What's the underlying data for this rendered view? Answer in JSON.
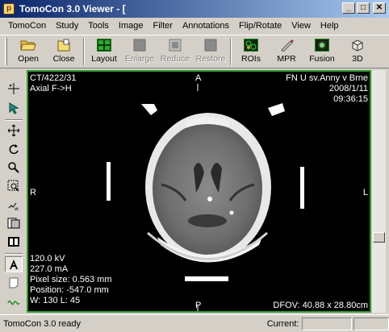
{
  "window": {
    "title": "TomoCon 3.0 Viewer - [",
    "app_icon_letter": "p",
    "minimize_label": "_",
    "maximize_label": "□",
    "close_label": "✕"
  },
  "menu": [
    "TomoCon",
    "Study",
    "Tools",
    "Image",
    "Filter",
    "Annotations",
    "Flip/Rotate",
    "View",
    "Help"
  ],
  "toolbar": {
    "open": "Open",
    "close": "Close",
    "layout": "Layout",
    "enlarge": "Enlarge",
    "reduce": "Reduce",
    "restore": "Restore",
    "rois": "ROIs",
    "mpr": "MPR",
    "fusion": "Fusion",
    "three_d": "3D"
  },
  "viewer": {
    "top_left": [
      "CT/4222/31",
      "Axial F->H"
    ],
    "top_center": "A",
    "top_right": [
      "FN U sv.Anny v Brne",
      "2008/1/11",
      "09:36:15"
    ],
    "left_mid": "R",
    "right_mid": "L",
    "bottom_left": [
      "120.0 kV",
      "227.0 mA",
      "Pixel size: 0.563 mm",
      "Position: -547.0 mm",
      "W: 130 L: 45"
    ],
    "bottom_center": "P",
    "bottom_right": "DFOV: 40.88 x 28.80cm"
  },
  "status": {
    "text": "TomoCon 3.0 ready",
    "current_label": "Current:"
  },
  "colors": {
    "titlebar_start": "#0a246a",
    "titlebar_end": "#a6caf0",
    "viewer_border": "#2f9a2f",
    "viewer_bg": "#000000"
  }
}
